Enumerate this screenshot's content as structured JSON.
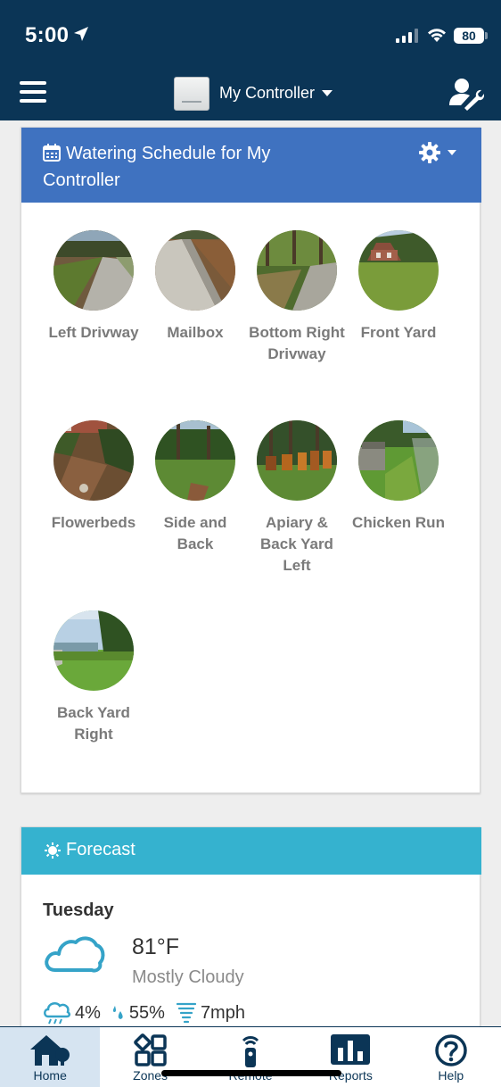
{
  "status_bar": {
    "time": "5:00",
    "battery": "80",
    "icons": [
      "location-arrow-icon",
      "cellular-signal-icon",
      "wifi-icon",
      "battery-icon"
    ]
  },
  "header": {
    "menu_icon": "hamburger-menu-icon",
    "controller_name": "My Controller",
    "user_icon": "user-settings-icon",
    "background_color": "#0b3556"
  },
  "schedule": {
    "title": "Watering Schedule for My Controller",
    "header_color": "#3f72c0",
    "zones": [
      {
        "label": "Left Drivway"
      },
      {
        "label": "Mailbox"
      },
      {
        "label": "Bottom Right Drivway"
      },
      {
        "label": "Front Yard"
      },
      {
        "label": "Flowerbeds"
      },
      {
        "label": "Side and Back"
      },
      {
        "label": "Apiary & Back Yard Left"
      },
      {
        "label": "Chicken Run"
      },
      {
        "label": "Back Yard Right"
      }
    ]
  },
  "forecast": {
    "title": "Forecast",
    "header_color": "#35b2cf",
    "day": "Tuesday",
    "temperature": "81°F",
    "condition": "Mostly Cloudy",
    "precipitation": "4%",
    "humidity": "55%",
    "wind": "7mph",
    "icon": "cloud-icon"
  },
  "tabs": [
    {
      "label": "Home",
      "icon": "home-icon",
      "active": true
    },
    {
      "label": "Zones",
      "icon": "zones-grid-icon",
      "active": false
    },
    {
      "label": "Remote",
      "icon": "remote-icon",
      "active": false
    },
    {
      "label": "Reports",
      "icon": "bar-chart-icon",
      "active": false
    },
    {
      "label": "Help",
      "icon": "help-icon",
      "active": false
    }
  ]
}
